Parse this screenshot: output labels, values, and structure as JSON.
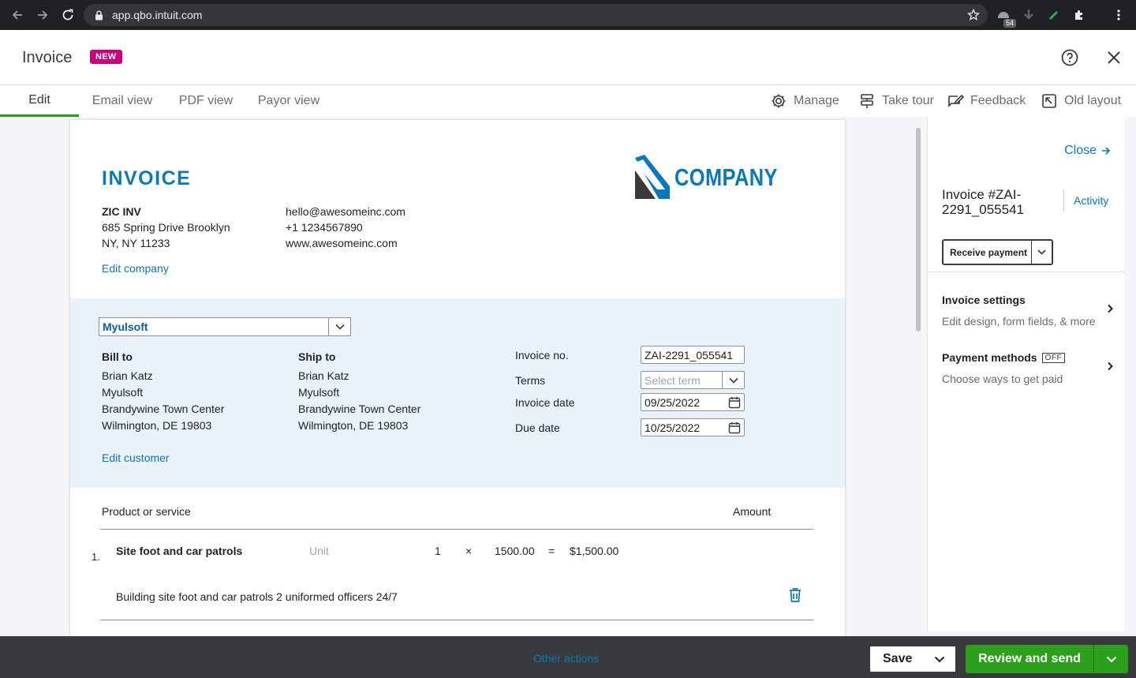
{
  "browser": {
    "url": "app.qbo.intuit.com",
    "extension_badge": "54"
  },
  "header": {
    "title": "Invoice",
    "badge": "NEW"
  },
  "tabs": [
    {
      "label": "Edit",
      "active": true
    },
    {
      "label": "Email view"
    },
    {
      "label": "PDF view"
    },
    {
      "label": "Payor view"
    }
  ],
  "toolbar": {
    "manage": "Manage",
    "take_tour": "Take tour",
    "feedback": "Feedback",
    "old_layout": "Old layout"
  },
  "invoice": {
    "heading": "INVOICE",
    "logo_text": "COMPANY",
    "company": {
      "name": "ZIC INV",
      "address_1": "685 Spring Drive Brooklyn",
      "address_2": "NY, NY 11233",
      "email": "hello@awesomeinc.com",
      "phone": "+1 1234567890",
      "website": "www.awesomeinc.com",
      "edit_link": "Edit company"
    },
    "customer": {
      "selected": "Myulsoft",
      "bill_to": {
        "label": "Bill to",
        "lines": [
          "Brian Katz",
          "Myulsoft",
          "Brandywine Town Center",
          "Wilmington, DE 19803"
        ]
      },
      "ship_to": {
        "label": "Ship to",
        "lines": [
          "Brian Katz",
          "Myulsoft",
          "Brandywine Town Center",
          "Wilmington, DE 19803"
        ]
      },
      "edit_link": "Edit customer"
    },
    "fields": {
      "invoice_no_label": "Invoice no.",
      "invoice_no": "ZAI-2291_055541",
      "terms_label": "Terms",
      "terms_placeholder": "Select term",
      "invoice_date_label": "Invoice date",
      "invoice_date": "09/25/2022",
      "due_date_label": "Due date",
      "due_date": "10/25/2022"
    },
    "lines_header": {
      "product": "Product or service",
      "amount": "Amount"
    },
    "lines": [
      {
        "number": "1.",
        "name": "Site foot and car patrols",
        "unit_placeholder": "Unit",
        "qty": "1",
        "times": "×",
        "rate": "1500.00",
        "equals": "=",
        "amount": "$1,500.00",
        "description": "Building site foot and car patrols 2 uniformed officers 24/7"
      }
    ]
  },
  "side_panel": {
    "close": "Close",
    "invoice_number": "Invoice #ZAI-2291_055541",
    "activity": "Activity",
    "receive_payment": "Receive payment",
    "settings_title": "Invoice settings",
    "settings_sub": "Edit design, form fields, & more",
    "payment_title": "Payment methods",
    "payment_badge": "OFF",
    "payment_sub": "Choose ways to get paid"
  },
  "footer": {
    "other_actions": "Other actions",
    "save": "Save",
    "review_send": "Review and send"
  },
  "colors": {
    "brand_blue": "#0b78b8",
    "green": "#2ca01c",
    "new_badge": "#c9007a",
    "bill_bg": "#e8f2f8"
  }
}
